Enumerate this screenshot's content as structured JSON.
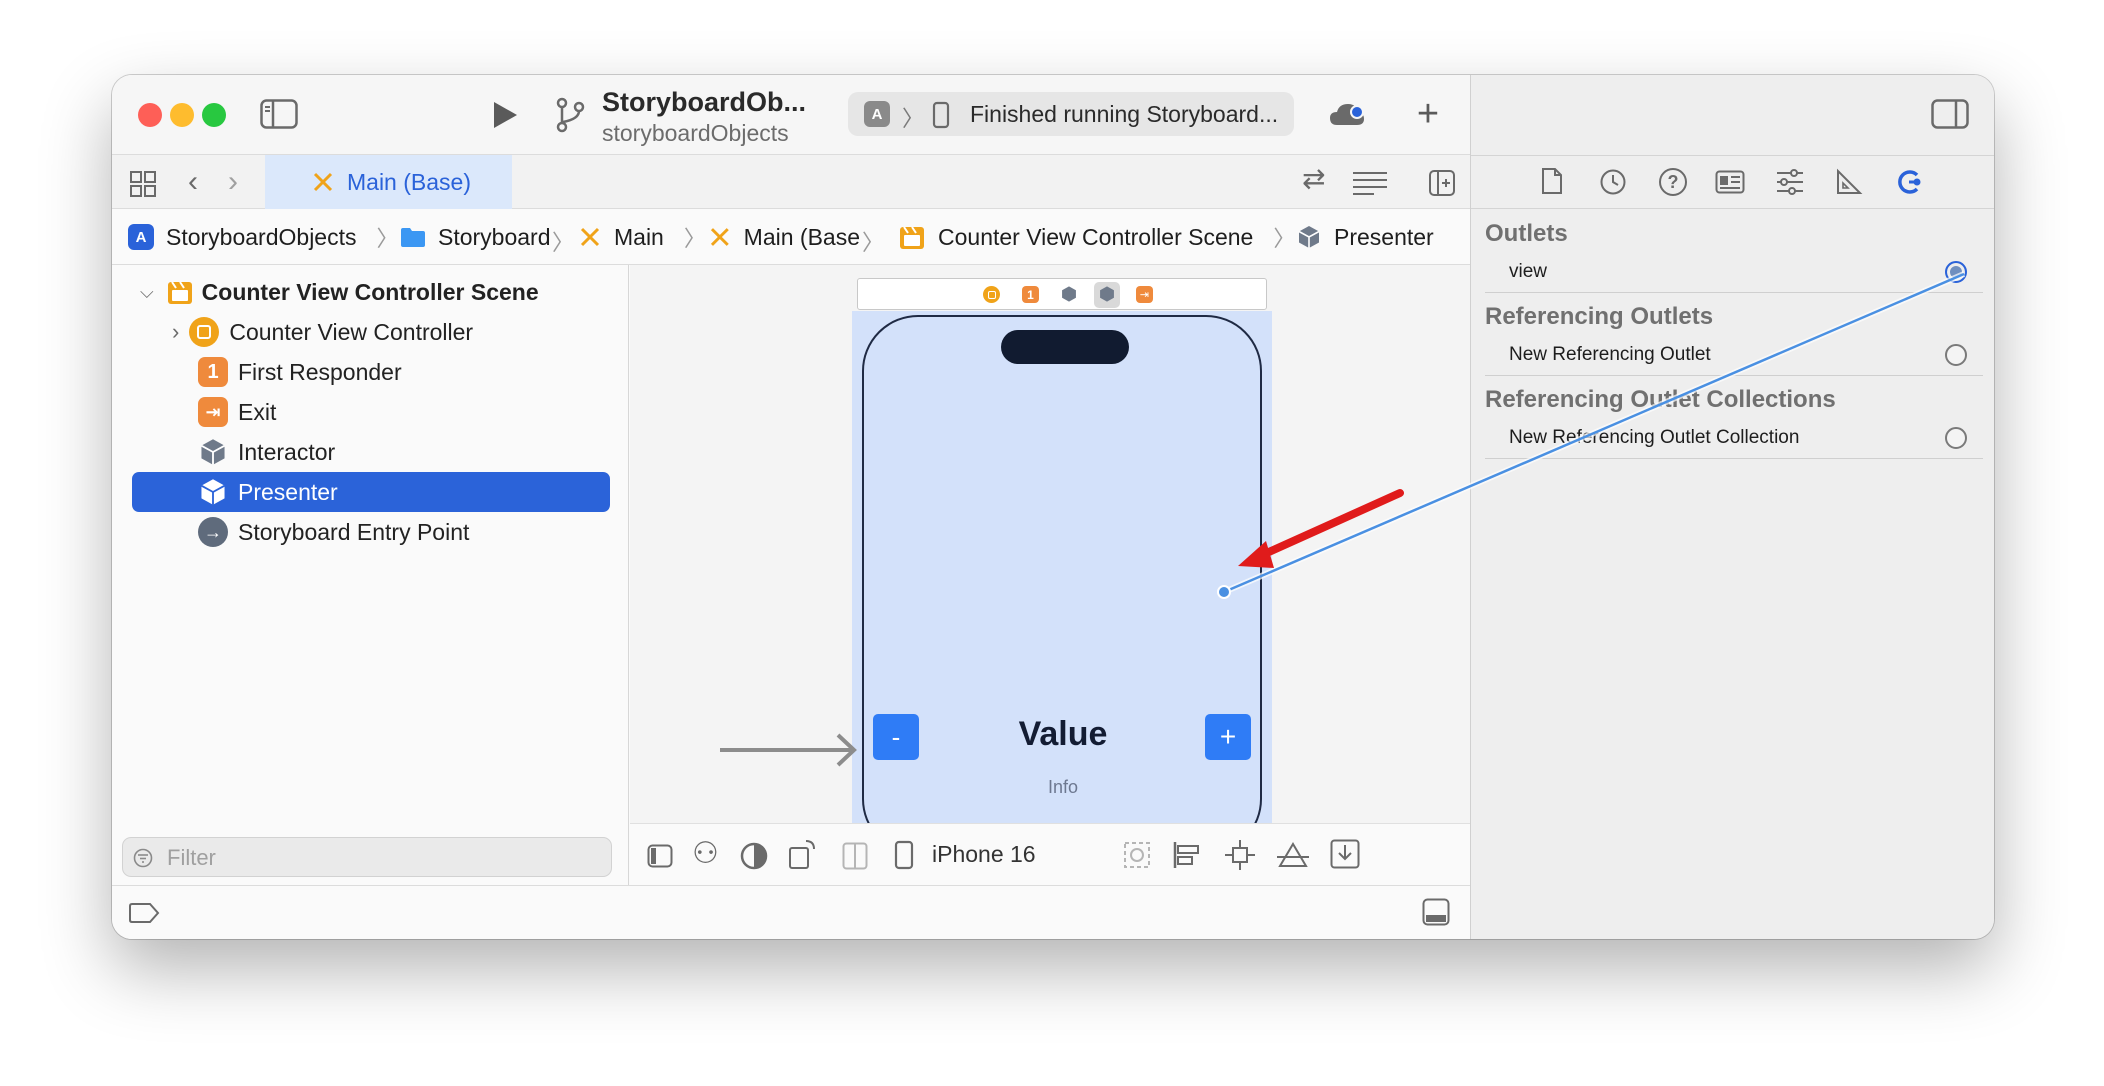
{
  "window": {
    "title": "StoryboardOb...",
    "subtitle": "storyboardObjects",
    "activity": "Finished running Storyboard..."
  },
  "tabs": [
    {
      "label": "Main (Base)",
      "active": true
    }
  ],
  "jumpbar": [
    {
      "label": "StoryboardObjects",
      "icon": "app-icon"
    },
    {
      "label": "Storyboard",
      "icon": "folder-icon"
    },
    {
      "label": "Main",
      "icon": "storyboard-icon"
    },
    {
      "label": "Main (Base",
      "icon": "storyboard-icon"
    },
    {
      "label": "Counter View Controller Scene",
      "icon": "scene-icon"
    },
    {
      "label": "Presenter",
      "icon": "cube-icon"
    }
  ],
  "navigator": {
    "scene": "Counter View Controller Scene",
    "items": [
      {
        "label": "Counter View Controller",
        "icon": "view-controller-icon",
        "badge": ""
      },
      {
        "label": "First Responder",
        "icon": "first-responder-icon",
        "badge": "1"
      },
      {
        "label": "Exit",
        "icon": "exit-icon",
        "badge": ""
      },
      {
        "label": "Interactor",
        "icon": "cube-icon",
        "badge": ""
      },
      {
        "label": "Presenter",
        "icon": "cube-icon",
        "badge": "",
        "selected": true
      },
      {
        "label": "Storyboard Entry Point",
        "icon": "arrow-right-icon",
        "badge": ""
      }
    ],
    "filter_placeholder": "Filter"
  },
  "canvas": {
    "device_label": "iPhone 16",
    "scene_badge_1": "1",
    "minus_label": "-",
    "plus_label": "+",
    "value_label": "Value",
    "info_label": "Info"
  },
  "inspector": {
    "outlets_header": "Outlets",
    "outlets": [
      "view"
    ],
    "referencing_header": "Referencing Outlets",
    "referencing_items": [
      "New Referencing Outlet"
    ],
    "collections_header": "Referencing Outlet Collections",
    "collection_items": [
      "New Referencing Outlet Collection"
    ]
  },
  "colors": {
    "accent": "#2a62d9",
    "selection": "#2b63d9",
    "tab_active": "#dbe8fb",
    "phone_bg": "#d3e1fa",
    "button_blue": "#2f7cf6",
    "arrow_red": "#e01b1b",
    "connection": "#4a90e2",
    "traffic_red": "#fe5f57",
    "traffic_yellow": "#febc2e",
    "traffic_green": "#28c840"
  }
}
